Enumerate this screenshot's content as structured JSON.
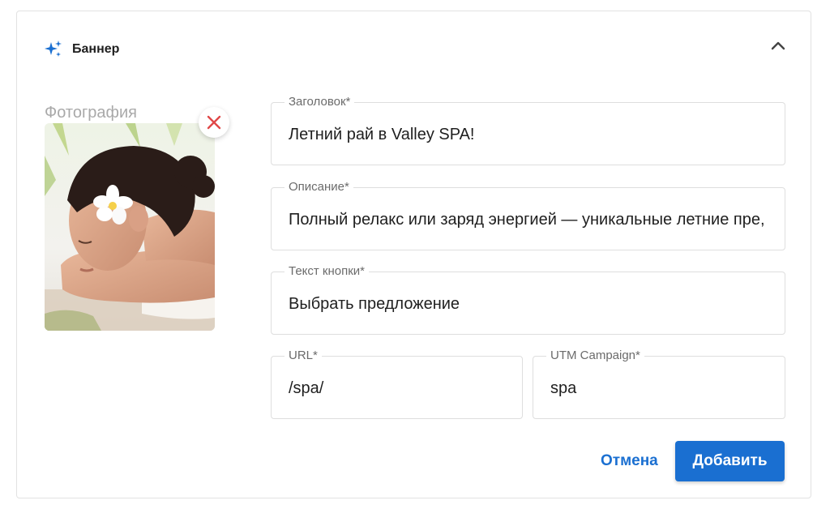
{
  "header": {
    "title": "Баннер",
    "icon": "sparkle-icon",
    "collapse_icon": "chevron-up-icon"
  },
  "photo": {
    "label": "Фотография",
    "remove_icon": "close-icon"
  },
  "fields": {
    "title": {
      "label": "Заголовок*",
      "value": "Летний рай в Valley SPA!"
    },
    "description": {
      "label": "Описание*",
      "value": "Полный релакс или заряд энергией — уникальные летние пре,"
    },
    "button_text": {
      "label": "Текст кнопки*",
      "value": "Выбрать предложение"
    },
    "url": {
      "label": "URL*",
      "value": "/spa/"
    },
    "utm_campaign": {
      "label": "UTM Campaign*",
      "value": "spa"
    }
  },
  "actions": {
    "cancel": "Отмена",
    "add": "Добавить"
  },
  "colors": {
    "accent": "#1a6fd1",
    "remove": "#e04848",
    "border": "#dedede"
  }
}
